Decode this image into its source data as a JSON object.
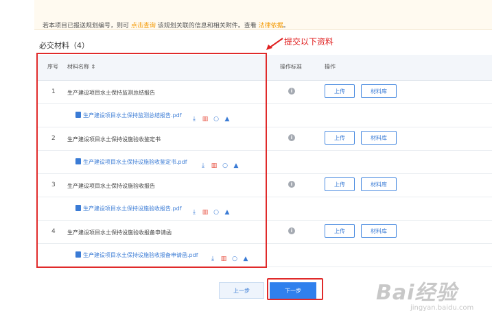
{
  "notice": {
    "prefix": "若本项目已报送规划编号，则可 ",
    "link1": "点击查询",
    "middle": " 该规划关联的信息和相关附件。查看 ",
    "link2": "法律依据",
    "suffix": "。"
  },
  "section_title": "必交材料（4）",
  "annotation": "提交以下资料",
  "table": {
    "headers": {
      "index": "序号",
      "name": "材料名称 ⇕",
      "standard": "操作标准",
      "actions": "操作"
    },
    "rows": [
      {
        "index": "1",
        "name": "生产建设项目水土保持监测总结报告",
        "file": "生产建设项目水土保持监测总结报告.pdf"
      },
      {
        "index": "2",
        "name": "生产建设项目水土保持设施验收鉴定书",
        "file": "生产建设项目水土保持设施验收鉴定书.pdf"
      },
      {
        "index": "3",
        "name": "生产建设项目水土保持设施验收报告",
        "file": "生产建设项目水土保持设施验收报告.pdf"
      },
      {
        "index": "4",
        "name": "生产建设项目水土保持设施验收报备申请函",
        "file": "生产建设项目水土保持设施验收报备申请函.pdf"
      }
    ],
    "upload_label": "上传",
    "library_label": "材料库"
  },
  "icons": {
    "info": "i",
    "download": "⤓",
    "delete": "▥",
    "view": "○",
    "user": "▲"
  },
  "nav": {
    "prev_label": "上一步",
    "next_label": "下一步"
  },
  "watermark": {
    "logo_text": "Bai经验",
    "url": "jingyan.baidu.com"
  },
  "colors": {
    "accent": "#2f80ed",
    "link": "#3a7bd5",
    "highlight": "#e02a2a",
    "delete": "#e74c3c"
  }
}
